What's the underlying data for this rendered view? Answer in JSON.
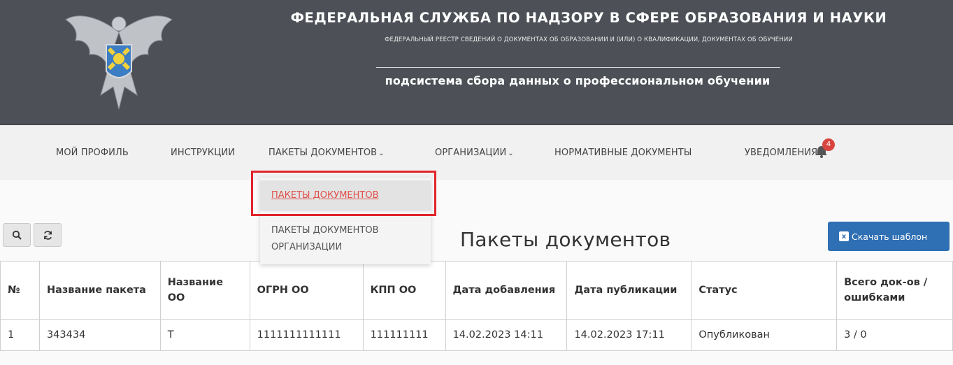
{
  "header": {
    "title": "ФЕДЕРАЛЬНАЯ СЛУЖБА ПО НАДЗОРУ В СФЕРЕ ОБРАЗОВАНИЯ И НАУКИ",
    "subtitle": "ФЕДЕРАЛЬНЫЙ РЕЕСТР СВЕДЕНИЙ О ДОКУМЕНТАХ ОБ ОБРАЗОВАНИИ И (ИЛИ) О КВАЛИФИКАЦИИ, ДОКУМЕНТАХ ОБ ОБУЧЕНИИ",
    "subsystem": "подсистема сбора данных о профессиональном обучении"
  },
  "nav": {
    "items": [
      {
        "label": "МОЙ ПРОФИЛЬ"
      },
      {
        "label": "ИНСТРУКЦИИ"
      },
      {
        "label": "ПАКЕТЫ ДОКУМЕНТОВ"
      },
      {
        "label": "ОРГАНИЗАЦИИ"
      },
      {
        "label": "НОРМАТИВНЫЕ ДОКУМЕНТЫ"
      },
      {
        "label": "УВЕДОМЛЕНИЯ"
      }
    ],
    "notifications_count": "4"
  },
  "dropdown": {
    "items": [
      {
        "label": "ПАКЕТЫ ДОКУМЕНТОВ"
      },
      {
        "label": "ПАКЕТЫ ДОКУМЕНТОВ ОРГАНИЗАЦИИ"
      }
    ]
  },
  "page": {
    "title": "Пакеты документов",
    "download_label": "Скачать шаблон"
  },
  "table": {
    "headers": [
      "№",
      "Название пакета",
      "Название ОО",
      "ОГРН ОО",
      "КПП ОО",
      "Дата добавления",
      "Дата публикации",
      "Статус",
      "Всего док-ов / ошибками"
    ],
    "rows": [
      [
        "1",
        "343434",
        "Т",
        "1111111111111",
        "111111111",
        "14.02.2023 14:11",
        "14.02.2023 17:11",
        "Опубликован",
        "3 / 0"
      ]
    ]
  },
  "colors": {
    "header_bg": "#4d5157",
    "accent_blue": "#2f6fb3",
    "highlight_red": "#e0252b",
    "badge_red": "#d9463f",
    "active_link": "#e0504a"
  }
}
